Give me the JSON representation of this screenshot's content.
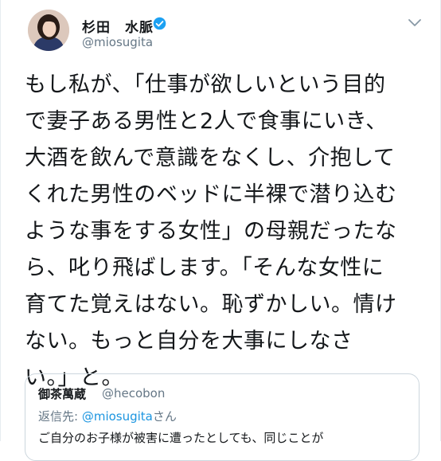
{
  "tweet": {
    "display_name": "杉田　水脈",
    "handle": "@miosugita",
    "verified": true,
    "body": "もし私が、「仕事が欲しいという目的\nで妻子ある男性と2人で食事にいき、\n大酒を飲んで意識をなくし、介抱して\nくれた男性のベッドに半裸で潜り込む\nような事をする女性」の母親だったな\nら、叱り飛ばします。「そんな女性に\n育てた覚えはない。恥ずかしい。情け\nない。もっと自分を大事にしなさ\nい。」と。"
  },
  "quoted_tweet": {
    "display_name": "御茶萬蔵",
    "handle": "@hecobon",
    "reply_prefix": "返信先: ",
    "reply_mention": "@miosugita",
    "reply_suffix": "さん",
    "text": "ご自分のお子様が被害に遭ったとしても、同じことが"
  },
  "colors": {
    "text": "#14171a",
    "secondary": "#657786",
    "link": "#1b95e0",
    "verified": "#1da1f2",
    "border": "#ccd6dd"
  },
  "icons": {
    "verified": "verified-badge-icon",
    "menu": "chevron-down-icon"
  }
}
